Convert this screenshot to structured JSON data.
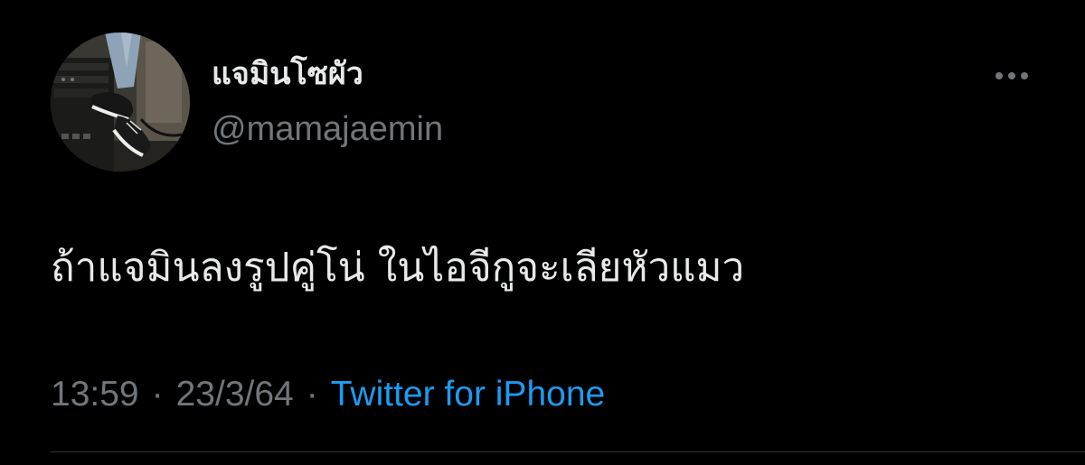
{
  "tweet": {
    "author": {
      "display_name": "แจมินโซผัว",
      "handle": "@mamajaemin",
      "avatar_icon": "avatar-photo-sneakers"
    },
    "more_icon": "more-horizontal-icon",
    "text": "ถ้าแจมินลงรูปคู่โน่ ในไอจีกูจะเลียหัวแมว",
    "time": "13:59",
    "separator": "·",
    "date": "23/3/64",
    "source": "Twitter for iPhone"
  },
  "colors": {
    "background": "#000000",
    "primary_text": "#e7e9ea",
    "secondary_text": "#71767b",
    "link": "#1d9bf0",
    "divider": "#2f3336"
  }
}
